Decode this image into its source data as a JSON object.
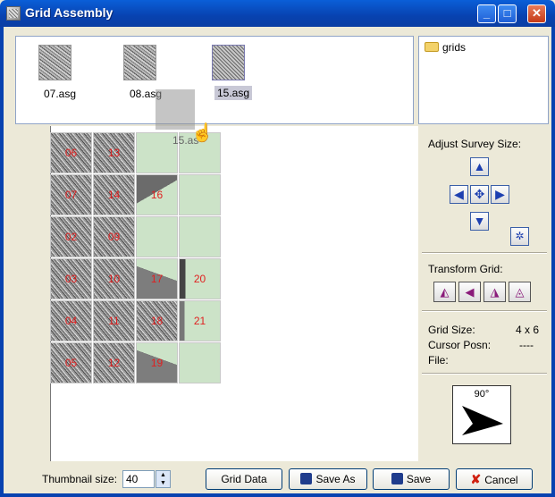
{
  "window": {
    "title": "Grid Assembly"
  },
  "thumbnails": [
    {
      "label": "07.asg"
    },
    {
      "label": "08.asg"
    },
    {
      "label": "15.asg"
    }
  ],
  "folders": [
    {
      "label": "grids"
    }
  ],
  "drag_ghost_label": "15.as",
  "grid_labels": [
    "06",
    "13",
    "07",
    "14",
    "16",
    "02",
    "09",
    "03",
    "10",
    "17",
    "20",
    "04",
    "11",
    "18",
    "21",
    "05",
    "12",
    "19"
  ],
  "right_panel": {
    "adjust_title": "Adjust Survey Size:",
    "transform_title": "Transform Grid:",
    "grid_size_label": "Grid Size:",
    "grid_size_value": "4 x 6",
    "cursor_label": "Cursor Posn:",
    "cursor_value": "----",
    "file_label": "File:",
    "compass_label": "90°"
  },
  "bottom": {
    "thumb_size_label": "Thumbnail size:",
    "thumb_size_value": "40",
    "grid_data": "Grid Data",
    "save_as": "Save As",
    "save": "Save",
    "cancel": "Cancel"
  },
  "colors": {
    "grid_empty": "#cce3c8",
    "grid_label": "#e02020",
    "titlebar": "#0842b0"
  }
}
